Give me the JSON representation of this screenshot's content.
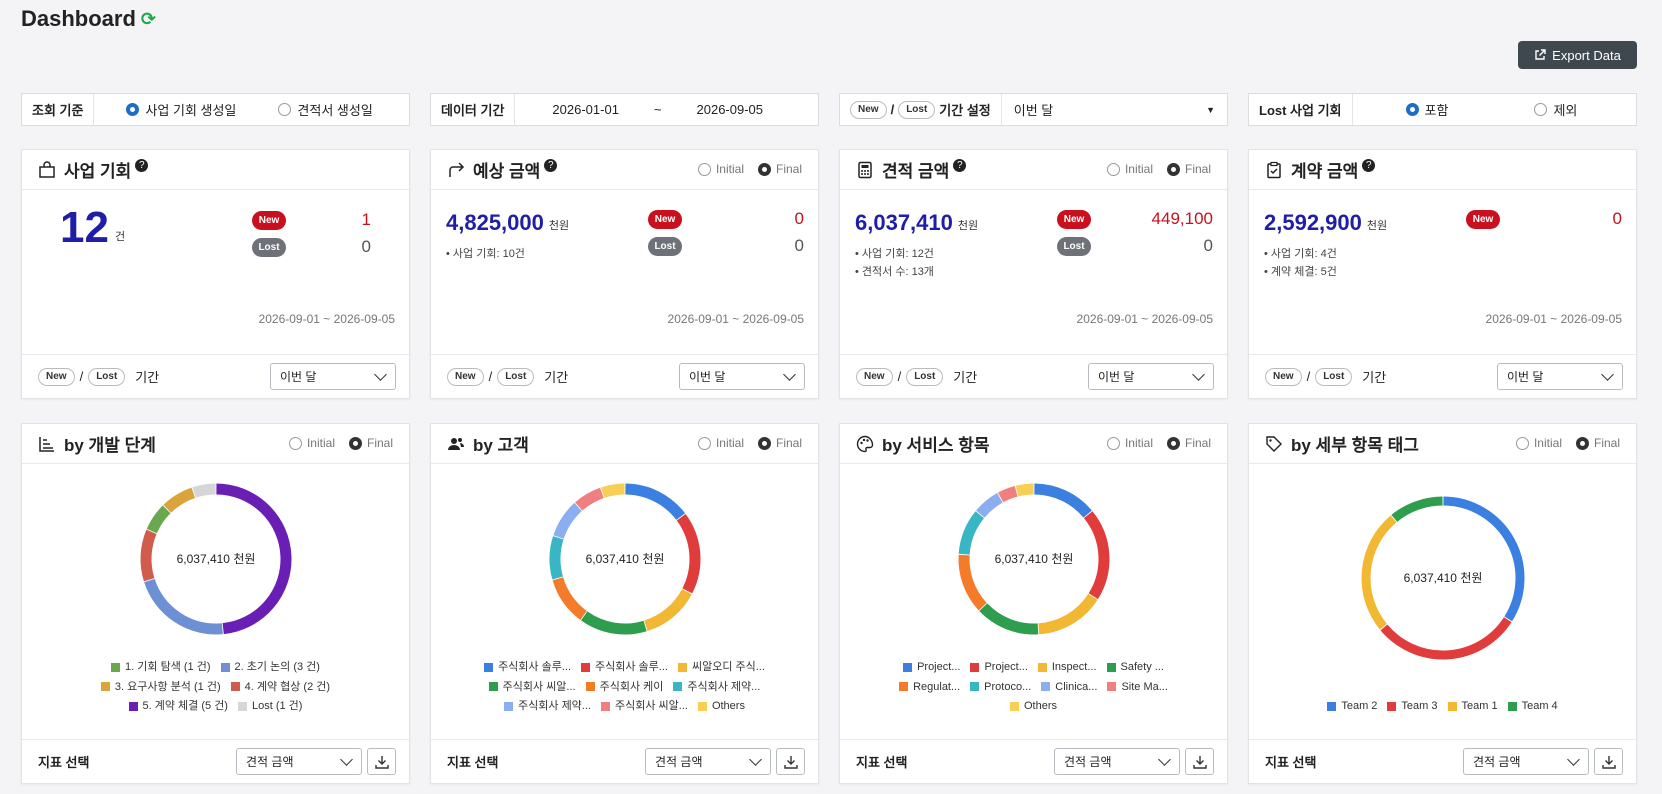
{
  "header": {
    "title": "Dashboard",
    "export_label": "Export Data"
  },
  "filters": {
    "criteria": {
      "label": "조회 기준",
      "opt1": "사업 기회 생성일",
      "opt2": "견적서 생성일"
    },
    "period": {
      "label": "데이터 기간",
      "start": "2026-01-01",
      "sep": "~",
      "end": "2026-09-05"
    },
    "newlost": {
      "new": "New",
      "slash": "/",
      "lost": "Lost",
      "label": "기간 설정",
      "value": "이번 달"
    },
    "lost_opp": {
      "label": "Lost 사업 기회",
      "opt1": "포함",
      "opt2": "제외"
    }
  },
  "common": {
    "new": "New",
    "lost": "Lost",
    "slash": "/",
    "initial": "Initial",
    "final": "Final",
    "period_label": "기간",
    "period_value": "이번 달",
    "range": "2026-09-01 ~ 2026-09-05",
    "metric_label": "지표 선택",
    "metric_value": "견적 금액",
    "q": "?"
  },
  "kpis": [
    {
      "title": "사업 기회",
      "value": "12",
      "unit": "건",
      "new": "1",
      "lost": "0",
      "notes": []
    },
    {
      "title": "예상 금액",
      "value": "4,825,000",
      "unit": "천원",
      "new": "0",
      "lost": "0",
      "notes": [
        "사업 기회: 10건"
      ]
    },
    {
      "title": "견적 금액",
      "value": "6,037,410",
      "unit": "천원",
      "new": "449,100",
      "lost": "0",
      "notes": [
        "사업 기회: 12건",
        "견적서 수: 13개"
      ]
    },
    {
      "title": "계약 금액",
      "value": "2,592,900",
      "unit": "천원",
      "new": "0",
      "lost": null,
      "notes": [
        "사업 기회: 4건",
        "계약 체결: 5건"
      ]
    }
  ],
  "chart_data": [
    {
      "type": "pie",
      "title": "by 개발 단계",
      "center_label": "6,037,410 천원",
      "labels": [
        "1. 기회 탐색 (1 건)",
        "2. 초기 논의 (3 건)",
        "3. 요구사항 분석 (1 건)",
        "4. 계약 협상 (2 건)",
        "5. 계약 체결 (5 건)",
        "Lost (1 건)"
      ],
      "colors": [
        "#6aa84f",
        "#6d8fd4",
        "#d9a53a",
        "#d05c4e",
        "#6a1fb4",
        "#d6d6d8"
      ],
      "values": [
        0.06,
        0.21,
        0.07,
        0.11,
        0.47,
        0.05
      ],
      "order": [
        4,
        1,
        3,
        0,
        2,
        5
      ],
      "legend_rows": [
        [
          0,
          1
        ],
        [
          2,
          3
        ],
        [
          4,
          5
        ]
      ]
    },
    {
      "type": "pie",
      "title": "by 고객",
      "center_label": "6,037,410 천원",
      "labels": [
        "주식회사 솔루...",
        "주식회사 솔루...",
        "씨알오디 주식...",
        "주식회사 씨알...",
        "주식회사 케이",
        "주식회사 제약...",
        "주식회사 제약...",
        "주식회사 씨알...",
        "Others"
      ],
      "colors": [
        "#3b7fe0",
        "#e03c3c",
        "#f2b733",
        "#2e9e4e",
        "#f47b2a",
        "#38b6c4",
        "#8aaef0",
        "#f08080",
        "#f7cf55"
      ],
      "values": [
        0.14,
        0.17,
        0.12,
        0.14,
        0.1,
        0.09,
        0.08,
        0.06,
        0.05
      ],
      "order": [
        0,
        1,
        2,
        3,
        4,
        5,
        6,
        7,
        8
      ],
      "legend_rows": [
        [
          0,
          1,
          2
        ],
        [
          3,
          4,
          5
        ],
        [
          6,
          7,
          8
        ]
      ]
    },
    {
      "type": "pie",
      "title": "by 서비스 항목",
      "center_label": "6,037,410 천원",
      "labels": [
        "Project...",
        "Project...",
        "Inspect...",
        "Safety ...",
        "Regulat...",
        "Protoco...",
        "Clinica...",
        "Site Ma...",
        "Others"
      ],
      "colors": [
        "#3b7fe0",
        "#e03c3c",
        "#f2b733",
        "#2e9e4e",
        "#f47b2a",
        "#38b6c4",
        "#8aaef0",
        "#f08080",
        "#f7cf55"
      ],
      "values": [
        0.14,
        0.2,
        0.15,
        0.14,
        0.13,
        0.1,
        0.06,
        0.04,
        0.04
      ],
      "order": [
        0,
        1,
        2,
        3,
        4,
        5,
        6,
        7,
        8
      ],
      "legend_rows": [
        [
          0,
          1,
          2,
          3
        ],
        [
          4,
          5,
          6,
          7
        ],
        [
          8
        ]
      ]
    },
    {
      "type": "pie",
      "title": "by 세부 항목 태그",
      "center_label": "6,037,410 천원",
      "labels": [
        "Team 2",
        "Team 3",
        "Team 1",
        "Team 4"
      ],
      "colors": [
        "#3b7fe0",
        "#e03c3c",
        "#f2b733",
        "#2e9e4e"
      ],
      "values": [
        0.34,
        0.3,
        0.25,
        0.11
      ],
      "order": [
        0,
        1,
        2,
        3
      ],
      "legend_rows": [
        [
          0,
          1,
          2,
          3
        ]
      ]
    }
  ]
}
